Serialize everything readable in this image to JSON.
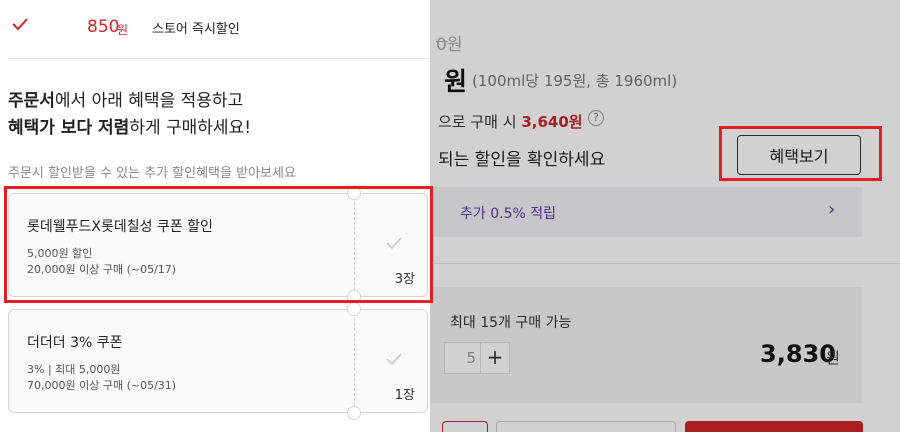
{
  "panel": {
    "store_discount_amount": "850",
    "store_discount_won": "원",
    "store_discount_label": "스토어 즉시할인",
    "headline": {
      "line1_bold": "주문서",
      "line1_rest": "에서 아래 혜택을 적용하고",
      "line2_bold": "혜택가 보다 저렴",
      "line2_rest": "하게 구매하세요!"
    },
    "subtitle": "주문시 할인받을 수 있는 추가 할인혜택을 받아보세요",
    "coupons": [
      {
        "name": "롯데웰푸드X롯데칠성 쿠폰 할인",
        "line1": "5,000원 할인",
        "line2": "20,000원 이상 구매 (~05/17)",
        "count": "3장"
      },
      {
        "name": "더더더 3% 쿠폰",
        "line1": "3% | 최대 5,000원",
        "line2": "70,000원 이상 구매 (~05/31)",
        "count": "1장"
      }
    ]
  },
  "product": {
    "original_price_fragment": "0원",
    "price_fragment": "원",
    "unit_info": "(100ml당 195원, 총 1960ml)",
    "buy_text": "으로 구매 시",
    "buy_price": "3,640원",
    "help_icon": "?",
    "check_discount_text": "되는 할인을 확인하세요",
    "benefit_button": "혜택보기",
    "point_text": "추가 0.5% 적립",
    "max_purchase": "최대 15개 구매 가능",
    "qty_fragment": "5",
    "plus": "+",
    "total_price": "3,830",
    "total_won": "원"
  },
  "colors": {
    "accent_red": "#d0252a",
    "highlight_red": "#e21f25",
    "point_purple": "#5c3bb0"
  }
}
